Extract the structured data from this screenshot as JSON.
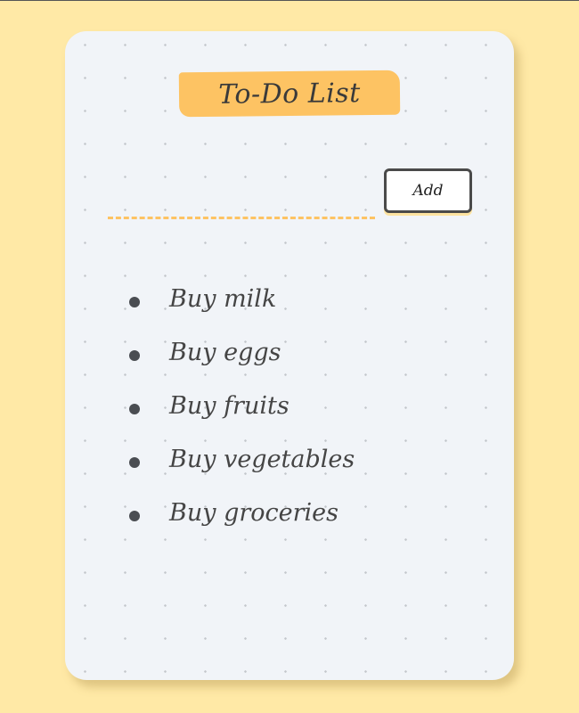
{
  "app": {
    "title": "To-Do List"
  },
  "form": {
    "input_value": "",
    "input_placeholder": "",
    "add_label": "Add"
  },
  "todos": [
    {
      "label": "Buy milk"
    },
    {
      "label": "Buy eggs"
    },
    {
      "label": "Buy fruits"
    },
    {
      "label": "Buy vegetables"
    },
    {
      "label": "Buy groceries"
    }
  ],
  "colors": {
    "background": "#ffe9a6",
    "card": "#f1f4f8",
    "accent": "#fdc363",
    "text": "#454545"
  }
}
